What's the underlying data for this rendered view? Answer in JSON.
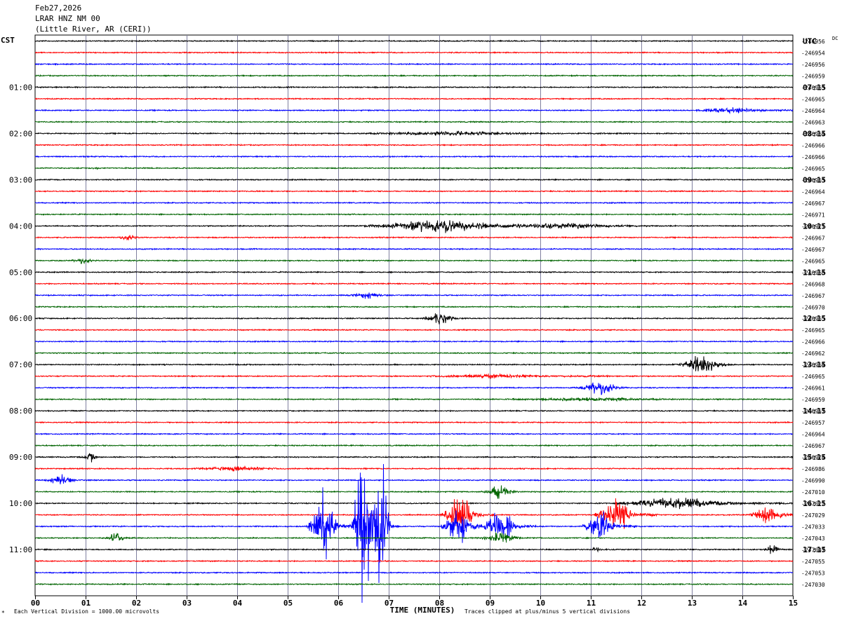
{
  "header": {
    "date": "Feb27,2026",
    "station": "LRAR HNZ NM 00",
    "location": "(Little River, AR (CERI))"
  },
  "footer": {
    "scale_note": "Each Vertical Division = 1000.00 microvolts",
    "clip_note": "Traces clipped at plus/minus 5 vertical divisions",
    "corner_mark": "*"
  },
  "colors": {
    "black": "#000000",
    "red": "#ff0000",
    "blue": "#0000ff",
    "green": "#006400",
    "grid": "#000080"
  },
  "chart_data": {
    "type": "line",
    "title": "",
    "xlabel": "TIME (MINUTES)",
    "left_axis_label": "CST",
    "right_axis_label": "UTC",
    "dc_label": "DC",
    "xlim": [
      0,
      15
    ],
    "x_tick_labels": [
      "00",
      "01",
      "02",
      "03",
      "04",
      "05",
      "06",
      "07",
      "08",
      "09",
      "10",
      "11",
      "12",
      "13",
      "14",
      "15"
    ],
    "trace_colors": [
      "black",
      "red",
      "blue",
      "green"
    ],
    "left_hour_labels": [
      "",
      "01:00",
      "02:00",
      "03:00",
      "04:00",
      "05:00",
      "06:00",
      "07:00",
      "08:00",
      "09:00",
      "10:00",
      "11:00"
    ],
    "right_hour_labels": [
      "UTC",
      "07:15",
      "08:15",
      "09:15",
      "10:15",
      "11:15",
      "12:15",
      "13:15",
      "14:15",
      "15:15",
      "16:15",
      "17:15"
    ],
    "dc_values": [
      "-246956",
      "-246954",
      "-246956",
      "-246959",
      "-246963",
      "-246965",
      "-246964",
      "-246963",
      "-246964",
      "-246966",
      "-246966",
      "-246965",
      "-246963",
      "-246964",
      "-246967",
      "-246971",
      "-246971",
      "-246967",
      "-246967",
      "-246965",
      "-246968",
      "-246968",
      "-246967",
      "-246970",
      "-246965",
      "-246965",
      "-246966",
      "-246962",
      "-246964",
      "-246965",
      "-246961",
      "-246959",
      "-246957",
      "-246957",
      "-246964",
      "-246967",
      "-246974",
      "-246986",
      "-246990",
      "-247010",
      "-247022",
      "-247029",
      "-247033",
      "-247043",
      "-247047",
      "-247055",
      "-247053",
      "-247030"
    ],
    "events": [
      {
        "trace": 6,
        "minute": 13.8,
        "amp": 3,
        "dur": 1.2,
        "noise": 1.5
      },
      {
        "trace": 8,
        "minute": 8.2,
        "amp": 3,
        "dur": 3,
        "noise": 1.2
      },
      {
        "trace": 11,
        "minute": 1.2,
        "amp": 1,
        "dur": 0.3,
        "noise": 0.8
      },
      {
        "trace": 16,
        "minute": 8.0,
        "amp": 8,
        "dur": 2.5,
        "noise": 1.5
      },
      {
        "trace": 16,
        "minute": 10.5,
        "amp": 3,
        "dur": 3,
        "noise": 1.0
      },
      {
        "trace": 17,
        "minute": 1.85,
        "amp": 6,
        "dur": 0.4,
        "noise": 0.8
      },
      {
        "trace": 19,
        "minute": 0.95,
        "amp": 6,
        "dur": 0.4,
        "noise": 0.8
      },
      {
        "trace": 22,
        "minute": 6.6,
        "amp": 7,
        "dur": 0.6,
        "noise": 0.8
      },
      {
        "trace": 24,
        "minute": 8.0,
        "amp": 13,
        "dur": 0.6,
        "noise": 0.8
      },
      {
        "trace": 28,
        "minute": 13.2,
        "amp": 22,
        "dur": 0.8,
        "noise": 1.0
      },
      {
        "trace": 29,
        "minute": 9.0,
        "amp": 2,
        "dur": 2,
        "noise": 1.5
      },
      {
        "trace": 30,
        "minute": 11.2,
        "amp": 14,
        "dur": 0.8,
        "noise": 1.0
      },
      {
        "trace": 31,
        "minute": 11.0,
        "amp": 2,
        "dur": 3,
        "noise": 1.2
      },
      {
        "trace": 36,
        "minute": 1.1,
        "amp": 9,
        "dur": 0.3,
        "noise": 1.0
      },
      {
        "trace": 37,
        "minute": 4.0,
        "amp": 3,
        "dur": 1.5,
        "noise": 1.2
      },
      {
        "trace": 38,
        "minute": 0.5,
        "amp": 10,
        "dur": 0.5,
        "noise": 1.2
      },
      {
        "trace": 39,
        "minute": 9.2,
        "amp": 10,
        "dur": 0.6,
        "noise": 1.2
      },
      {
        "trace": 40,
        "minute": 12.7,
        "amp": 6,
        "dur": 2,
        "noise": 1.8
      },
      {
        "trace": 41,
        "minute": 8.4,
        "amp": 16,
        "dur": 0.6,
        "noise": 2.5
      },
      {
        "trace": 41,
        "minute": 11.5,
        "amp": 14,
        "dur": 0.7,
        "noise": 2.5
      },
      {
        "trace": 41,
        "minute": 14.5,
        "amp": 7,
        "dur": 0.6,
        "noise": 2.5
      },
      {
        "trace": 42,
        "minute": 5.7,
        "amp": 35,
        "dur": 0.5,
        "noise": 2.5
      },
      {
        "trace": 42,
        "minute": 6.5,
        "amp": 80,
        "dur": 0.4,
        "noise": 2.5
      },
      {
        "trace": 42,
        "minute": 6.85,
        "amp": 60,
        "dur": 0.3,
        "noise": 2.5
      },
      {
        "trace": 42,
        "minute": 8.4,
        "amp": 18,
        "dur": 0.6,
        "noise": 2.5
      },
      {
        "trace": 42,
        "minute": 9.2,
        "amp": 16,
        "dur": 0.6,
        "noise": 2.5
      },
      {
        "trace": 42,
        "minute": 11.2,
        "amp": 12,
        "dur": 0.6,
        "noise": 2.5
      },
      {
        "trace": 43,
        "minute": 1.6,
        "amp": 8,
        "dur": 0.4,
        "noise": 1.2
      },
      {
        "trace": 43,
        "minute": 9.2,
        "amp": 9,
        "dur": 0.7,
        "noise": 1.2
      },
      {
        "trace": 44,
        "minute": 14.6,
        "amp": 10,
        "dur": 0.3,
        "noise": 1.2
      },
      {
        "trace": 44,
        "minute": 11.1,
        "amp": 4,
        "dur": 0.2,
        "noise": 1.2
      }
    ]
  }
}
